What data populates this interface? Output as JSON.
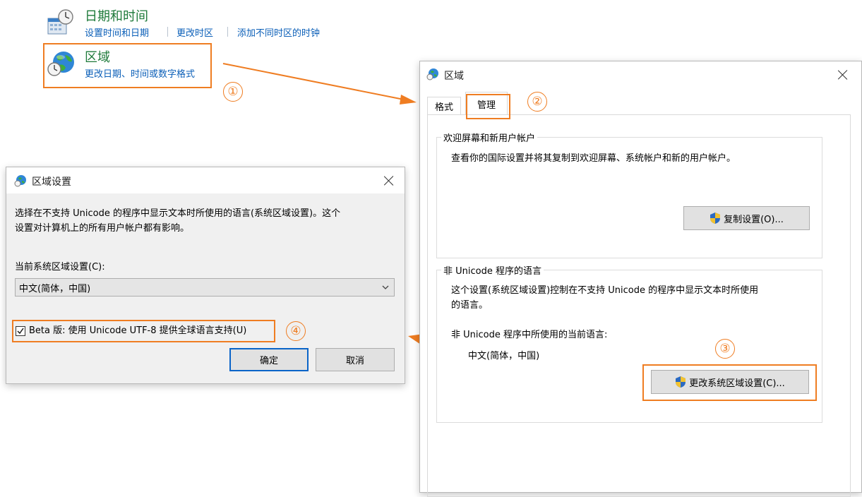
{
  "control_panel": {
    "datetime": {
      "title": "日期和时间",
      "links": [
        "设置时间和日期",
        "更改时区",
        "添加不同时区的时钟"
      ]
    },
    "region": {
      "title": "区域",
      "link": "更改日期、时间或数字格式"
    }
  },
  "region_window": {
    "title": "区域",
    "tabs": [
      "格式",
      "管理"
    ],
    "welcome_group": {
      "legend": "欢迎屏幕和新用户帐户",
      "description": "查看你的国际设置并将其复制到欢迎屏幕、系统帐户和新的用户帐户。",
      "button": "复制设置(O)..."
    },
    "nonunicode_group": {
      "legend": "非 Unicode 程序的语言",
      "description_line1": "这个设置(系统区域设置)控制在不支持 Unicode 的程序中显示文本时所使用",
      "description_line2": "的语言。",
      "current_label": "非 Unicode 程序中所使用的当前语言:",
      "current_value": "中文(简体，中国)",
      "button": "更改系统区域设置(C)..."
    }
  },
  "region_settings_dialog": {
    "title": "区域设置",
    "description_line1": "选择在不支持 Unicode 的程序中显示文本时所使用的语言(系统区域设置)。这个",
    "description_line2": "设置对计算机上的所有用户帐户都有影响。",
    "locale_label": "当前系统区域设置(C):",
    "locale_value": "中文(简体，中国)",
    "beta_checkbox_label": "Beta 版: 使用 Unicode UTF-8 提供全球语言支持(U)",
    "beta_checked": true,
    "ok_button": "确定",
    "cancel_button": "取消"
  },
  "annotations": {
    "step1": "①",
    "step2": "②",
    "step3": "③",
    "step4": "④"
  },
  "colors": {
    "annotation_orange": "#ef7d22",
    "link_blue": "#0b5fb8",
    "title_green": "#1e7a3a"
  }
}
